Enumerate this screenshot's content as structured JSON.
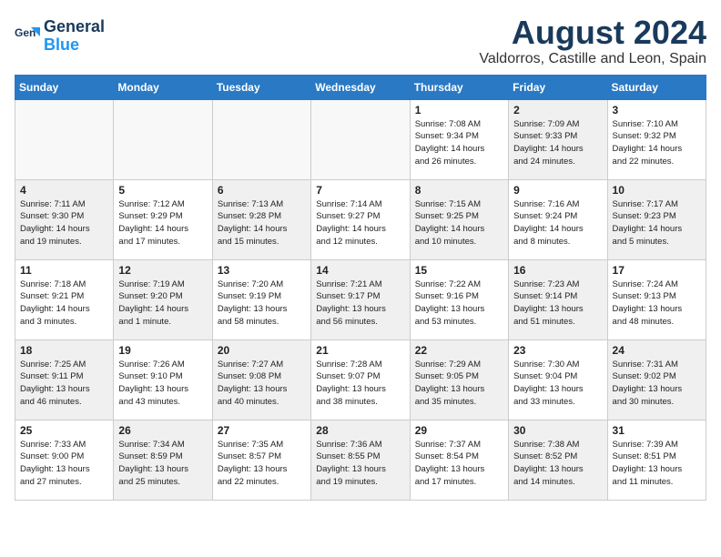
{
  "logo": {
    "line1": "General",
    "line2": "Blue"
  },
  "title": {
    "month_year": "August 2024",
    "location": "Valdorros, Castille and Leon, Spain"
  },
  "headers": [
    "Sunday",
    "Monday",
    "Tuesday",
    "Wednesday",
    "Thursday",
    "Friday",
    "Saturday"
  ],
  "weeks": [
    [
      {
        "day": "",
        "info": "",
        "empty": true
      },
      {
        "day": "",
        "info": "",
        "empty": true
      },
      {
        "day": "",
        "info": "",
        "empty": true
      },
      {
        "day": "",
        "info": "",
        "empty": true
      },
      {
        "day": "1",
        "info": "Sunrise: 7:08 AM\nSunset: 9:34 PM\nDaylight: 14 hours\nand 26 minutes.",
        "shaded": false
      },
      {
        "day": "2",
        "info": "Sunrise: 7:09 AM\nSunset: 9:33 PM\nDaylight: 14 hours\nand 24 minutes.",
        "shaded": true
      },
      {
        "day": "3",
        "info": "Sunrise: 7:10 AM\nSunset: 9:32 PM\nDaylight: 14 hours\nand 22 minutes.",
        "shaded": false
      }
    ],
    [
      {
        "day": "4",
        "info": "Sunrise: 7:11 AM\nSunset: 9:30 PM\nDaylight: 14 hours\nand 19 minutes.",
        "shaded": true
      },
      {
        "day": "5",
        "info": "Sunrise: 7:12 AM\nSunset: 9:29 PM\nDaylight: 14 hours\nand 17 minutes.",
        "shaded": false
      },
      {
        "day": "6",
        "info": "Sunrise: 7:13 AM\nSunset: 9:28 PM\nDaylight: 14 hours\nand 15 minutes.",
        "shaded": true
      },
      {
        "day": "7",
        "info": "Sunrise: 7:14 AM\nSunset: 9:27 PM\nDaylight: 14 hours\nand 12 minutes.",
        "shaded": false
      },
      {
        "day": "8",
        "info": "Sunrise: 7:15 AM\nSunset: 9:25 PM\nDaylight: 14 hours\nand 10 minutes.",
        "shaded": true
      },
      {
        "day": "9",
        "info": "Sunrise: 7:16 AM\nSunset: 9:24 PM\nDaylight: 14 hours\nand 8 minutes.",
        "shaded": false
      },
      {
        "day": "10",
        "info": "Sunrise: 7:17 AM\nSunset: 9:23 PM\nDaylight: 14 hours\nand 5 minutes.",
        "shaded": true
      }
    ],
    [
      {
        "day": "11",
        "info": "Sunrise: 7:18 AM\nSunset: 9:21 PM\nDaylight: 14 hours\nand 3 minutes.",
        "shaded": false
      },
      {
        "day": "12",
        "info": "Sunrise: 7:19 AM\nSunset: 9:20 PM\nDaylight: 14 hours\nand 1 minute.",
        "shaded": true
      },
      {
        "day": "13",
        "info": "Sunrise: 7:20 AM\nSunset: 9:19 PM\nDaylight: 13 hours\nand 58 minutes.",
        "shaded": false
      },
      {
        "day": "14",
        "info": "Sunrise: 7:21 AM\nSunset: 9:17 PM\nDaylight: 13 hours\nand 56 minutes.",
        "shaded": true
      },
      {
        "day": "15",
        "info": "Sunrise: 7:22 AM\nSunset: 9:16 PM\nDaylight: 13 hours\nand 53 minutes.",
        "shaded": false
      },
      {
        "day": "16",
        "info": "Sunrise: 7:23 AM\nSunset: 9:14 PM\nDaylight: 13 hours\nand 51 minutes.",
        "shaded": true
      },
      {
        "day": "17",
        "info": "Sunrise: 7:24 AM\nSunset: 9:13 PM\nDaylight: 13 hours\nand 48 minutes.",
        "shaded": false
      }
    ],
    [
      {
        "day": "18",
        "info": "Sunrise: 7:25 AM\nSunset: 9:11 PM\nDaylight: 13 hours\nand 46 minutes.",
        "shaded": true
      },
      {
        "day": "19",
        "info": "Sunrise: 7:26 AM\nSunset: 9:10 PM\nDaylight: 13 hours\nand 43 minutes.",
        "shaded": false
      },
      {
        "day": "20",
        "info": "Sunrise: 7:27 AM\nSunset: 9:08 PM\nDaylight: 13 hours\nand 40 minutes.",
        "shaded": true
      },
      {
        "day": "21",
        "info": "Sunrise: 7:28 AM\nSunset: 9:07 PM\nDaylight: 13 hours\nand 38 minutes.",
        "shaded": false
      },
      {
        "day": "22",
        "info": "Sunrise: 7:29 AM\nSunset: 9:05 PM\nDaylight: 13 hours\nand 35 minutes.",
        "shaded": true
      },
      {
        "day": "23",
        "info": "Sunrise: 7:30 AM\nSunset: 9:04 PM\nDaylight: 13 hours\nand 33 minutes.",
        "shaded": false
      },
      {
        "day": "24",
        "info": "Sunrise: 7:31 AM\nSunset: 9:02 PM\nDaylight: 13 hours\nand 30 minutes.",
        "shaded": true
      }
    ],
    [
      {
        "day": "25",
        "info": "Sunrise: 7:33 AM\nSunset: 9:00 PM\nDaylight: 13 hours\nand 27 minutes.",
        "shaded": false
      },
      {
        "day": "26",
        "info": "Sunrise: 7:34 AM\nSunset: 8:59 PM\nDaylight: 13 hours\nand 25 minutes.",
        "shaded": true
      },
      {
        "day": "27",
        "info": "Sunrise: 7:35 AM\nSunset: 8:57 PM\nDaylight: 13 hours\nand 22 minutes.",
        "shaded": false
      },
      {
        "day": "28",
        "info": "Sunrise: 7:36 AM\nSunset: 8:55 PM\nDaylight: 13 hours\nand 19 minutes.",
        "shaded": true
      },
      {
        "day": "29",
        "info": "Sunrise: 7:37 AM\nSunset: 8:54 PM\nDaylight: 13 hours\nand 17 minutes.",
        "shaded": false
      },
      {
        "day": "30",
        "info": "Sunrise: 7:38 AM\nSunset: 8:52 PM\nDaylight: 13 hours\nand 14 minutes.",
        "shaded": true
      },
      {
        "day": "31",
        "info": "Sunrise: 7:39 AM\nSunset: 8:51 PM\nDaylight: 13 hours\nand 11 minutes.",
        "shaded": false
      }
    ]
  ]
}
